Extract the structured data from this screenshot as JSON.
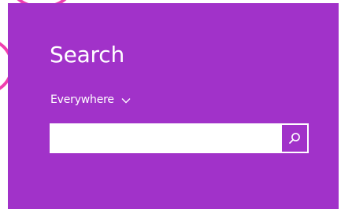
{
  "search_pane": {
    "title": "Search",
    "scope": {
      "selected": "Everywhere",
      "icon": "chevron-down-icon"
    },
    "input": {
      "value": "",
      "placeholder": ""
    },
    "button": {
      "icon": "magnifier-icon"
    }
  },
  "colors": {
    "pane_background": "#a132c9",
    "accent_arc": "#ef3fb0",
    "text": "#ffffff",
    "input_background": "#ffffff"
  }
}
